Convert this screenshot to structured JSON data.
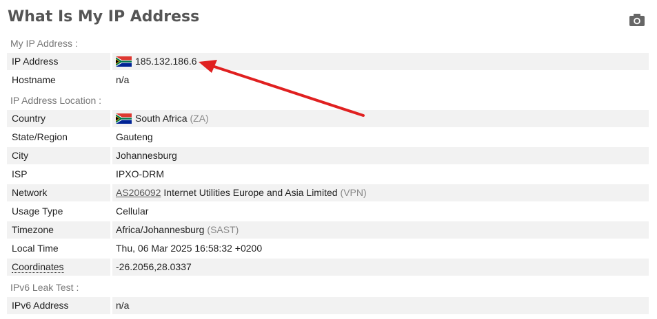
{
  "title": "What Is My IP Address",
  "camera_icon": "camera-icon",
  "sections": {
    "my_ip": "My IP Address :",
    "location": "IP Address Location :",
    "ipv6": "IPv6 Leak Test :"
  },
  "rows": {
    "ip": {
      "label": "IP Address",
      "value": "185.132.186.6",
      "icon": "south-africa-flag-icon"
    },
    "hostname": {
      "label": "Hostname",
      "value": "n/a"
    },
    "country": {
      "label": "Country",
      "value": "South Africa",
      "code": "(ZA)",
      "icon": "south-africa-flag-icon"
    },
    "state": {
      "label": "State/Region",
      "value": "Gauteng"
    },
    "city": {
      "label": "City",
      "value": "Johannesburg"
    },
    "isp": {
      "label": "ISP",
      "value": "IPXO-DRM"
    },
    "network": {
      "label": "Network",
      "as_link": "AS206092",
      "value": "Internet Utilities Europe and Asia Limited",
      "tag": "(VPN)"
    },
    "usage": {
      "label": "Usage Type",
      "value": "Cellular"
    },
    "timezone": {
      "label": "Timezone",
      "value": "Africa/Johannesburg",
      "abbr": "(SAST)"
    },
    "local_time": {
      "label": "Local Time",
      "value": "Thu, 06 Mar 2025 16:58:32 +0200"
    },
    "coordinates": {
      "label": "Coordinates",
      "value": "-26.2056,28.0337"
    },
    "ipv6_address": {
      "label": "IPv6 Address",
      "value": "n/a"
    }
  },
  "colors": {
    "stripe": "#f2f2f2",
    "arrow": "#e02020",
    "title": "#555555"
  }
}
